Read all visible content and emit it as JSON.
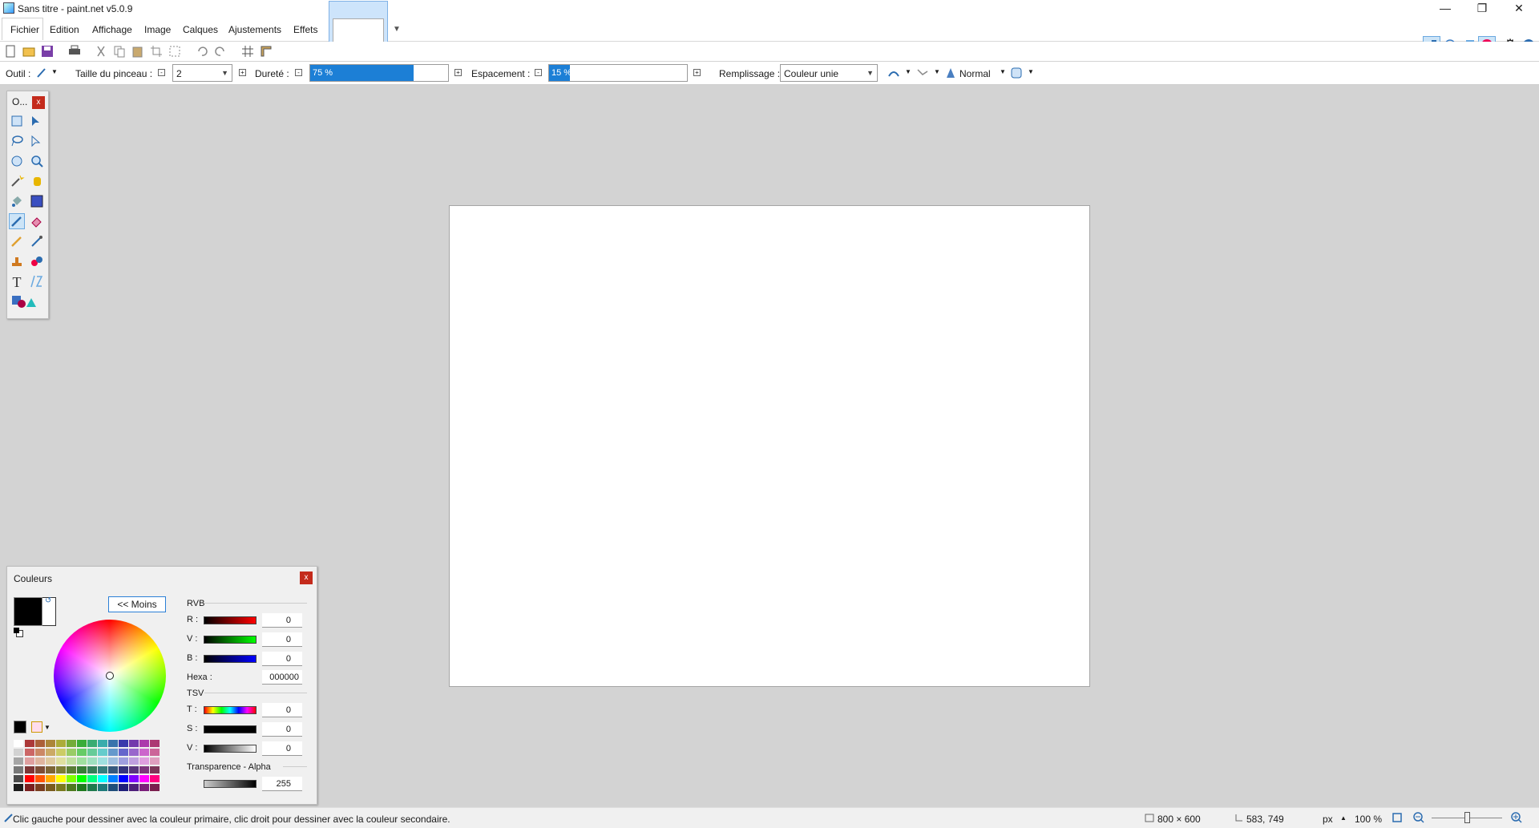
{
  "window": {
    "title": "Sans titre - paint.net v5.0.9"
  },
  "menu": [
    "Fichier",
    "Edition",
    "Affichage",
    "Image",
    "Calques",
    "Ajustements",
    "Effets"
  ],
  "toolbar2": {
    "tool_label": "Outil :",
    "brush_size_label": "Taille du pinceau :",
    "brush_size_value": "2",
    "hardness_label": "Dureté :",
    "hardness_value": "75 %",
    "hardness_percent": 75,
    "spacing_label": "Espacement :",
    "spacing_value": "15 %",
    "spacing_percent": 15,
    "fill_label": "Remplissage :",
    "fill_value": "Couleur unie",
    "blend_mode": "Normal"
  },
  "tools_window": {
    "title": "O..."
  },
  "colors_window": {
    "title": "Couleurs",
    "less_button": "<< Moins",
    "rgb_label": "RVB",
    "r_label": "R :",
    "r_value": "0",
    "g_label": "V :",
    "g_value": "0",
    "b_label": "B :",
    "b_value": "0",
    "hex_label": "Hexa :",
    "hex_value": "000000",
    "hsv_label": "TSV",
    "h_label": "T :",
    "h_value": "0",
    "s_label": "S :",
    "s_value": "0",
    "v_label": "V :",
    "v_value": "0",
    "alpha_label": "Transparence - Alpha",
    "alpha_value": "255",
    "primary_color": "#000000",
    "secondary_color": "#ffffff"
  },
  "status": {
    "hint": "Clic gauche pour dessiner avec la couleur primaire, clic droit pour dessiner avec la couleur secondaire.",
    "image_size": "800 × 600",
    "cursor_pos": "583, 749",
    "unit": "px",
    "zoom": "100 %"
  },
  "colors": {
    "accent": "#1c7fd6",
    "workspace": "#d3d3d3",
    "close_red": "#c42b1c"
  }
}
